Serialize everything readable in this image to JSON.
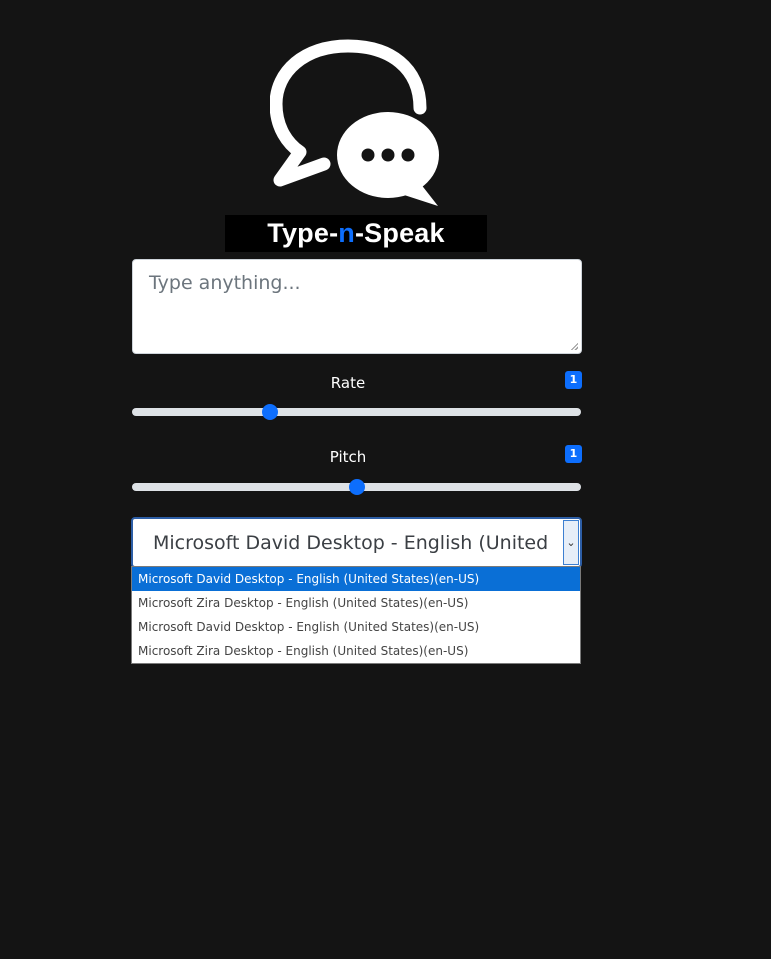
{
  "app": {
    "brand_prefix": "Type-",
    "brand_accent": "n",
    "brand_suffix": "-Speak",
    "accent_color": "#0d6efd",
    "logo_icon": "chat-bubbles-icon"
  },
  "text_input": {
    "placeholder": "Type anything...",
    "value": ""
  },
  "rate": {
    "label": "Rate",
    "badge": "1",
    "fraction": 0.3
  },
  "pitch": {
    "label": "Pitch",
    "badge": "1",
    "fraction": 0.5
  },
  "voice_select": {
    "selected": "Microsoft David Desktop - English (United States)",
    "arrow_icon": "chevron-down-icon",
    "options": [
      "Microsoft David Desktop - English (United States)(en-US)",
      "Microsoft Zira Desktop - English (United States)(en-US)",
      "Microsoft David Desktop - English (United States)(en-US)",
      "Microsoft Zira Desktop - English (United States)(en-US)"
    ],
    "highlighted_index": 0
  }
}
